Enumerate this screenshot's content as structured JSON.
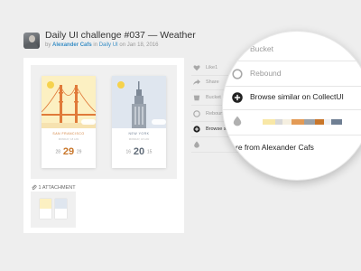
{
  "shot": {
    "title": "Daily UI challenge #037 — Weather",
    "by_label": "by",
    "author": "Alexander Cafs",
    "in_label": "in",
    "team": "Daily UI",
    "on_label": "on",
    "date": "Jan 18, 2016"
  },
  "weather_cards": [
    {
      "city": "SAN FRANCISCO",
      "date": "MONDAY, 18 JAN",
      "low": "28",
      "temp": "29",
      "high": "29",
      "accent": "#c8762a"
    },
    {
      "city": "NEW YORK",
      "date": "MONDAY, 18 JAN",
      "low": "16",
      "temp": "20",
      "high": "15",
      "accent": "#606b78"
    }
  ],
  "attachments": {
    "label": "1 ATTACHMENT"
  },
  "sidebar": {
    "items": [
      {
        "label": "Like1",
        "icon": "heart-icon"
      },
      {
        "label": "Share",
        "icon": "share-icon"
      },
      {
        "label": "Bucket",
        "icon": "bucket-icon"
      },
      {
        "label": "Rebound",
        "icon": "rebound-icon"
      },
      {
        "label": "Browse similar",
        "icon": "plus-circle-icon"
      }
    ]
  },
  "magnifier": {
    "bucket": "Bucket",
    "rebound": "Rebound",
    "browse_similar": "Browse similar on CollectUI",
    "more_from": "re from Alexander Cafs"
  },
  "palette": [
    "#f8e7a6",
    "#d8d8d8",
    "#f5efe0",
    "#e39a55",
    "#9aa1a8",
    "#c8762a",
    "#eef0f3",
    "#6f7f93"
  ],
  "colors": {
    "link": "#3a8fc6",
    "text": "#333333",
    "muted": "#9a9a9a"
  }
}
